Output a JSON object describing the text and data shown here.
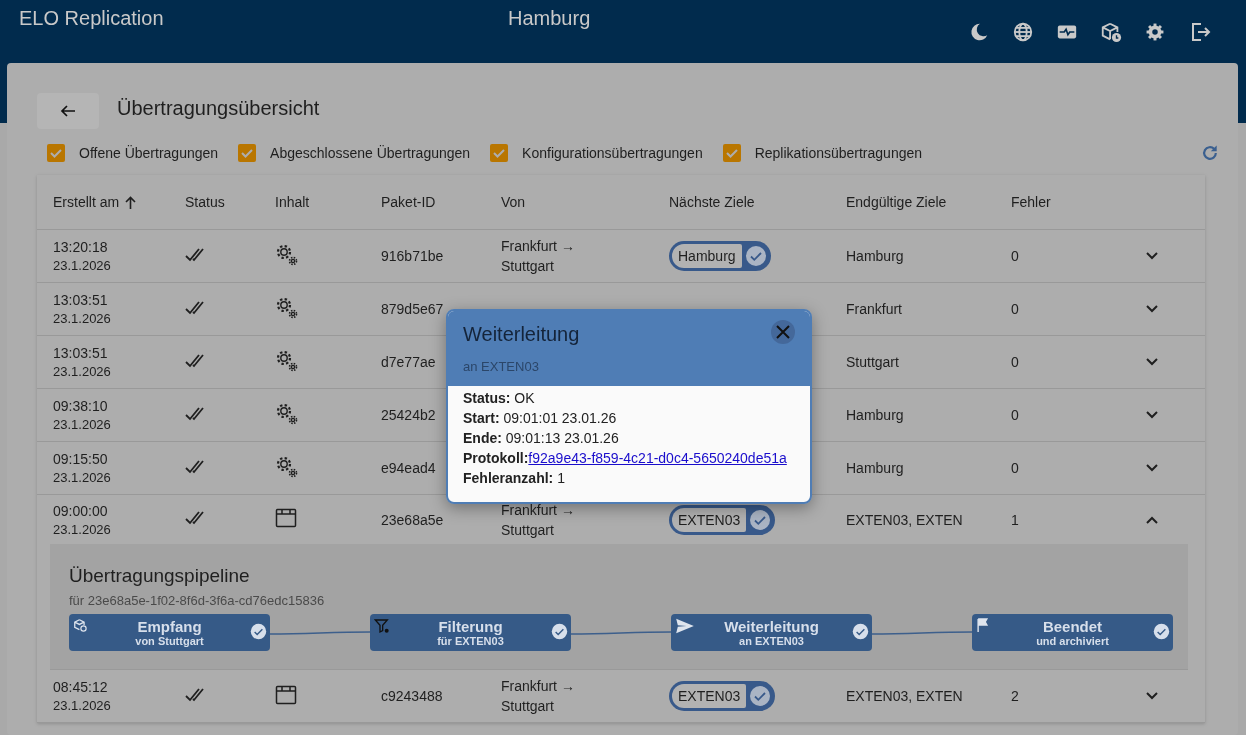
{
  "app": {
    "title": "ELO Replication",
    "location": "Hamburg"
  },
  "page": {
    "title": "Übertragungsübersicht"
  },
  "filters": [
    {
      "label": "Offene Übertragungen",
      "checked": true
    },
    {
      "label": "Abgeschlossene Übertragungen",
      "checked": true
    },
    {
      "label": "Konfigurationsübertragungen",
      "checked": true
    },
    {
      "label": "Replikationsübertragungen",
      "checked": true
    }
  ],
  "table": {
    "columns": [
      {
        "label": "Erstellt am",
        "sorted": true
      },
      {
        "label": "Status"
      },
      {
        "label": "Inhalt"
      },
      {
        "label": "Paket-ID"
      },
      {
        "label": "Von"
      },
      {
        "label": "Nächste Ziele"
      },
      {
        "label": "Endgültige Ziele"
      },
      {
        "label": "Fehler"
      }
    ],
    "rows": [
      {
        "time": "13:20:18",
        "date": "23.1.2026",
        "status": {
          "kind": "delivered"
        },
        "content": {
          "kind": "configuration"
        },
        "id": "916b71be",
        "from": "Frankfurt → Stuttgart",
        "next_target": {
          "label": "Hamburg",
          "done": true
        },
        "final": "Hamburg",
        "errors": "0",
        "expanded": false
      },
      {
        "time": "13:03:51",
        "date": "23.1.2026",
        "status": {
          "kind": "delivered"
        },
        "content": {
          "kind": "configuration"
        },
        "id": "879d5e67",
        "final": "Frankfurt",
        "errors": "0",
        "expanded": false
      },
      {
        "time": "13:03:51",
        "date": "23.1.2026",
        "status": {
          "kind": "delivered"
        },
        "content": {
          "kind": "configuration"
        },
        "id": "d7e77ae",
        "final": "Stuttgart",
        "errors": "0",
        "expanded": false
      },
      {
        "time": "09:38:10",
        "date": "23.1.2026",
        "status": {
          "kind": "delivered"
        },
        "content": {
          "kind": "configuration"
        },
        "id": "25424b2",
        "final": "Hamburg",
        "errors": "0",
        "expanded": false
      },
      {
        "time": "09:15:50",
        "date": "23.1.2026",
        "status": {
          "kind": "delivered"
        },
        "content": {
          "kind": "configuration"
        },
        "id": "e94ead4",
        "final": "Hamburg",
        "errors": "0",
        "expanded": false
      },
      {
        "time": "09:00:00",
        "date": "23.1.2026",
        "status": {
          "kind": "delivered"
        },
        "content": {
          "kind": "replication"
        },
        "id": "23e68a5e",
        "from": "Frankfurt → Stuttgart",
        "next_target": {
          "label": "EXTEN03",
          "done": true
        },
        "final": "EXTEN03, EXTEN",
        "errors": "1",
        "expanded": true,
        "pipeline": {
          "title": "Übertragungspipeline",
          "subtitle": "für 23e68a5e-1f02-8f6d-3f6a-cd76edc15836",
          "stages": [
            {
              "kind": "receive",
              "title": "Empfang",
              "subtitle": "von Stuttgart",
              "done": true
            },
            {
              "kind": "filter",
              "title": "Filterung",
              "subtitle": "für EXTEN03",
              "done": true
            },
            {
              "kind": "forward",
              "title": "Weiterleitung",
              "subtitle": "an EXTEN03",
              "done": true
            },
            {
              "kind": "finish",
              "title": "Beendet",
              "subtitle": "und archiviert",
              "done": true
            }
          ]
        }
      },
      {
        "time": "08:45:12",
        "date": "23.1.2026",
        "status": {
          "kind": "delivered"
        },
        "content": {
          "kind": "replication"
        },
        "id": "c9243488",
        "from": "Frankfurt → Stuttgart",
        "next_target": {
          "label": "EXTEN03",
          "done": true
        },
        "final": "EXTEN03, EXTEN",
        "errors": "2",
        "expanded": false
      }
    ]
  },
  "dialog": {
    "title": "Weiterleitung",
    "subtitle": "an EXTEN03",
    "fields": [
      {
        "label": "Status:",
        "value": "OK"
      },
      {
        "label": "Start:",
        "value": "09:01:01 23.01.26"
      },
      {
        "label": "Ende:",
        "value": "09:01:13 23.01.26"
      },
      {
        "label": "Protokoll:",
        "link": "f92a9e43-f859-4c21-d0c4-5650240de51a"
      },
      {
        "label": "Fehleranzahl:",
        "value": "1"
      }
    ]
  }
}
